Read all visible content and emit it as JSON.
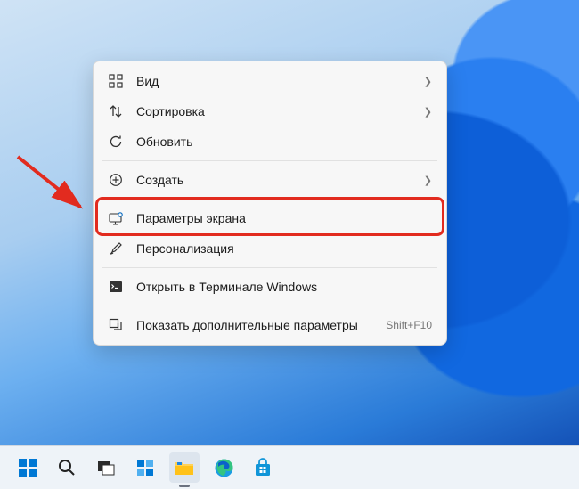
{
  "context_menu": {
    "items": [
      {
        "label": "Вид",
        "has_submenu": true
      },
      {
        "label": "Сортировка",
        "has_submenu": true
      },
      {
        "label": "Обновить",
        "has_submenu": false
      },
      {
        "label": "Создать",
        "has_submenu": true
      },
      {
        "label": "Параметры экрана",
        "has_submenu": false
      },
      {
        "label": "Персонализация",
        "has_submenu": false
      },
      {
        "label": "Открыть в Терминале Windows",
        "has_submenu": false
      },
      {
        "label": "Показать дополнительные параметры",
        "has_submenu": false,
        "shortcut": "Shift+F10"
      }
    ],
    "highlighted_index": 4
  },
  "annotation": {
    "arrow_color": "#e22b1f"
  }
}
